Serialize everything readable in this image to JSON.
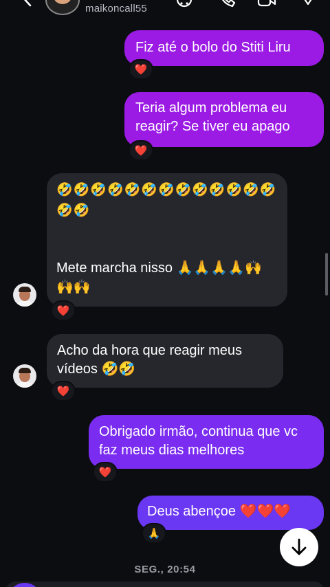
{
  "header": {
    "username": "maikoncall55"
  },
  "messages": [
    {
      "from": "me",
      "text": "Fiz até o bolo do Stiti Liru",
      "reaction": "❤️"
    },
    {
      "from": "me",
      "text": "Teria algum problema eu reagir? Se tiver eu apago",
      "reaction": "❤️"
    },
    {
      "from": "them",
      "emojis": "🤣🤣🤣🤣🤣🤣🤣🤣🤣🤣🤣🤣🤣🤣🤣",
      "text": "Mete marcha nisso 🙏🙏🙏🙏🙌🙌🙌",
      "reaction": "❤️"
    },
    {
      "from": "them",
      "text": "Acho da hora que reagir meus vídeos 🤣🤣",
      "reaction": "❤️"
    },
    {
      "from": "me",
      "text": "Obrigado irmão, continua que vc faz meus dias melhores",
      "reaction": "❤️"
    },
    {
      "from": "me",
      "text": "Deus abençoe ❤️❤️❤️",
      "reaction": "🙏"
    }
  ],
  "date_separator": "SEG., 20:54",
  "colors": {
    "background": "#0c0d11",
    "incoming_bubble": "#26272d",
    "outgoing_top": "#9b1be4",
    "outgoing_bottom": "#6a37f2"
  },
  "icons": {
    "back": "chevron-left-icon",
    "header_actions": [
      "emoji-icon",
      "phone-icon",
      "video-icon",
      "heart-icon"
    ],
    "scroll_down": "arrow-down-icon"
  }
}
